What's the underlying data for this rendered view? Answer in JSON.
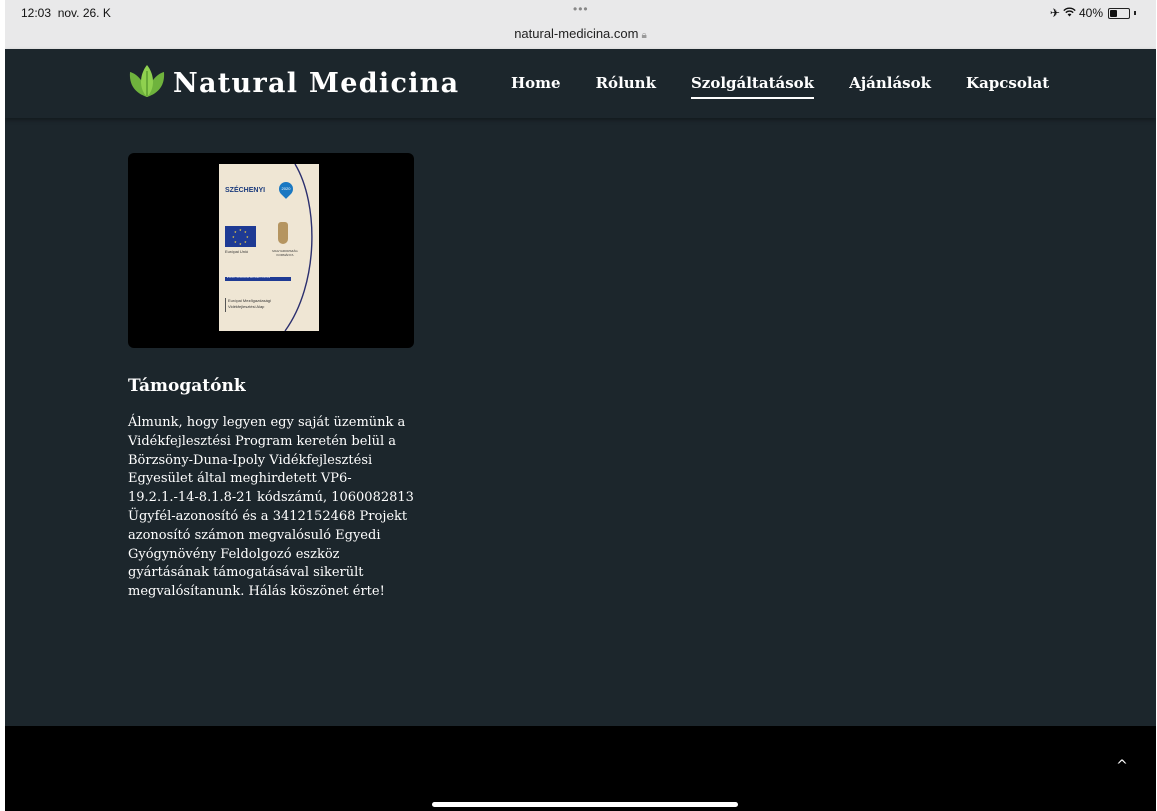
{
  "status_bar": {
    "time": "12:03",
    "date": "nov. 26. K",
    "dots": "•••",
    "url": "natural-medicina.com",
    "battery_percent": "40%",
    "battery_level": 0.4
  },
  "header": {
    "logo_text": "Natural Medicina",
    "logo_icon": "leaf-icon",
    "nav": [
      {
        "label": "Home",
        "active": false
      },
      {
        "label": "Rólunk",
        "active": false
      },
      {
        "label": "Szolgáltatások",
        "active": true
      },
      {
        "label": "Ajánlások",
        "active": false
      },
      {
        "label": "Kapcsolat",
        "active": false
      }
    ]
  },
  "card": {
    "poster": {
      "title": "SZÉCHENYI",
      "badge": "2020",
      "eu_caption": "Európai Unió",
      "crest_caption": "MAGYARORSZÁG KORMÁNYA",
      "band_text": "A VIDÉKI TÉRSÉGEKBE BERUHÁZÓ EURÓPA",
      "footer_line1": "Európai Mezőgazdasági",
      "footer_line2": "Vidékfejlesztési Alap"
    },
    "title": "Támogatónk",
    "text": "Álmunk, hogy legyen egy saját üzemünk a Vidékfejlesztési Program keretén belül a Börzsöny-Duna-Ipoly Vidékfejlesztési Egyesület által meghirdetett VP6-19.2.1.-14-8.1.8-21 kódszámú, 1060082813 Ügyfél-azonosító és a 3412152468 Projekt azonosító számon megvalósuló Egyedi Gyógynövény Feldolgozó eszköz gyártásának támogatásával sikerült megvalósítanunk. Hálás köszönet érte!"
  },
  "footer": {
    "scroll_top_icon": "chevron-up-icon",
    "scroll_top_glyph": "^"
  },
  "colors": {
    "background": "#1c262c",
    "leaf_green": "#7cc243",
    "footer": "#000000"
  }
}
